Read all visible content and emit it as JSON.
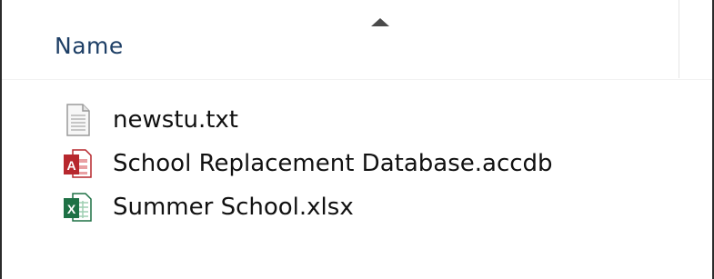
{
  "header": {
    "columns": [
      {
        "label": "Name",
        "sorted": "ascending"
      }
    ]
  },
  "files": [
    {
      "name": "newstu.txt",
      "icon": "text-file-icon"
    },
    {
      "name": "School Replacement Database.accdb",
      "icon": "access-file-icon"
    },
    {
      "name": "Summer School.xlsx",
      "icon": "excel-file-icon"
    }
  ],
  "colors": {
    "header_text": "#1e3f66",
    "access_red": "#b7282e",
    "excel_green": "#1e7145"
  }
}
